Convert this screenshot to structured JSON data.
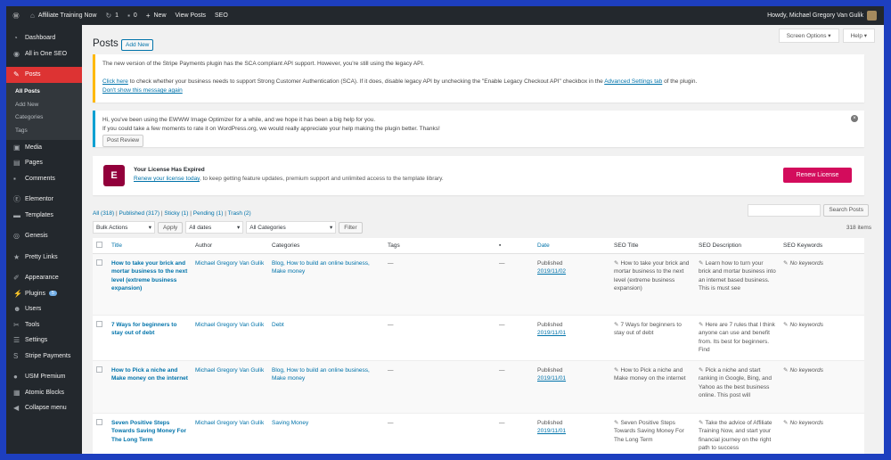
{
  "adminbar": {
    "site_name": "Affiliate Training Now",
    "updates_count": "1",
    "comments_count": "0",
    "new_label": "New",
    "view_posts": "View Posts",
    "seo": "SEO",
    "howdy": "Howdy, Michael Gregory Van Gulik"
  },
  "sidebar": {
    "items": [
      {
        "label": "Dashboard",
        "icon": "dashboard-icon"
      },
      {
        "label": "All in One SEO",
        "icon": "seo-icon"
      },
      {
        "label": "Posts",
        "icon": "pin-icon"
      },
      {
        "label": "Media",
        "icon": "media-icon"
      },
      {
        "label": "Pages",
        "icon": "pages-icon"
      },
      {
        "label": "Comments",
        "icon": "comments-icon"
      },
      {
        "label": "Elementor",
        "icon": "elementor-icon"
      },
      {
        "label": "Templates",
        "icon": "folder-icon"
      },
      {
        "label": "Genesis",
        "icon": "genesis-icon"
      },
      {
        "label": "Pretty Links",
        "icon": "link-icon"
      },
      {
        "label": "Appearance",
        "icon": "brush-icon"
      },
      {
        "label": "Plugins",
        "icon": "plugin-icon",
        "badge": "5"
      },
      {
        "label": "Users",
        "icon": "users-icon"
      },
      {
        "label": "Tools",
        "icon": "tools-icon"
      },
      {
        "label": "Settings",
        "icon": "settings-icon"
      },
      {
        "label": "Stripe Payments",
        "icon": "stripe-icon"
      },
      {
        "label": "USM Premium",
        "icon": "usm-icon"
      },
      {
        "label": "Atomic Blocks",
        "icon": "blocks-icon"
      },
      {
        "label": "Collapse menu",
        "icon": "collapse-icon"
      }
    ],
    "posts_submenu": [
      "All Posts",
      "Add New",
      "Categories",
      "Tags"
    ]
  },
  "header": {
    "screen_options": "Screen Options ▾",
    "help": "Help ▾",
    "title": "Posts",
    "add_new": "Add New"
  },
  "notices": {
    "stripe_line1": "The new version of the Stripe Payments plugin has the SCA compliant API support. However, you're still using the legacy API.",
    "stripe_click_here": "Click here",
    "stripe_line2": " to check whether your business needs to support Strong Customer Authentication (SCA). If it does, disable legacy API by unchecking the \"Enable Legacy Checkout API\" checkbox in the ",
    "stripe_adv_link": "Advanced Settings tab",
    "stripe_line2_end": " of the plugin.",
    "stripe_dont_show": "Don't show this message again",
    "ewww_line1": "Hi, you've been using the EWWW Image Optimizer for a while, and we hope it has been a big help for you.",
    "ewww_line2": "If you could take a few moments to rate it on WordPress.org, we would really appreciate your help making the plugin better. Thanks!",
    "ewww_button": "Post Review",
    "license_title": "Your License Has Expired",
    "license_link": "Renew your license today",
    "license_text": ", to keep getting feature updates, premium support and unlimited access to the template library.",
    "license_button": "Renew License"
  },
  "filters": {
    "all": "All (318)",
    "published": "Published (317)",
    "sticky": "Sticky (1)",
    "pending": "Pending (1)",
    "trash": "Trash (2)",
    "search_button": "Search Posts",
    "bulk_actions": "Bulk Actions",
    "apply": "Apply",
    "all_dates": "All dates",
    "all_categories": "All Categories",
    "filter": "Filter",
    "items_count": "318 items"
  },
  "table": {
    "headers": {
      "title": "Title",
      "author": "Author",
      "categories": "Categories",
      "tags": "Tags",
      "date": "Date",
      "seo_title": "SEO Title",
      "seo_desc": "SEO Description",
      "seo_kw": "SEO Keywords"
    },
    "rows": [
      {
        "title": "How to take your brick and mortar business to the next level (extreme business expansion)",
        "author": "Michael Gregory Van Gulik",
        "categories": "Blog, How to build an online business, Make money",
        "tags": "—",
        "comments": "—",
        "status": "Published",
        "date": "2019/11/02",
        "seo_title": "How to take your brick and mortar business to the next level (extreme business expansion)",
        "seo_desc": "Learn how to turn your brick and mortar business into an internet based business. This is must see",
        "seo_kw": "No keywords"
      },
      {
        "title": "7 Ways for beginners to stay out of debt",
        "author": "Michael Gregory Van Gulik",
        "categories": "Debt",
        "tags": "—",
        "comments": "—",
        "status": "Published",
        "date": "2019/11/01",
        "seo_title": "7 Ways for beginners to stay out of debt",
        "seo_desc": "Here are 7 rules that I think anyone can use and benefit from. Its best for beginners. Find",
        "seo_kw": "No keywords"
      },
      {
        "title": "How to Pick a niche and Make money on the internet",
        "author": "Michael Gregory Van Gulik",
        "categories": "Blog, How to build an online business, Make money",
        "tags": "—",
        "comments": "—",
        "status": "Published",
        "date": "2019/11/01",
        "seo_title": "How to Pick a niche and Make money on the internet",
        "seo_desc": "Pick a niche and start ranking in Google, Bing, and Yahoo as the best business online. This post will",
        "seo_kw": "No keywords"
      },
      {
        "title": "Seven Positive Steps Towards Saving Money For The Long Term",
        "author": "Michael Gregory Van Gulik",
        "categories": "Saving Money",
        "tags": "—",
        "comments": "—",
        "status": "Published",
        "date": "2019/11/01",
        "seo_title": "Seven Positive Steps Towards Saving Money For The Long Term",
        "seo_desc": "Take the advice of Affiliate Training Now, and start your financial journey on the right path to success",
        "seo_kw": "No keywords"
      }
    ]
  },
  "colors": {
    "admin_dark": "#23282d",
    "active_menu": "#dd3333",
    "link": "#0073aa",
    "elementor": "#92003b",
    "renew": "#d30c5c"
  }
}
